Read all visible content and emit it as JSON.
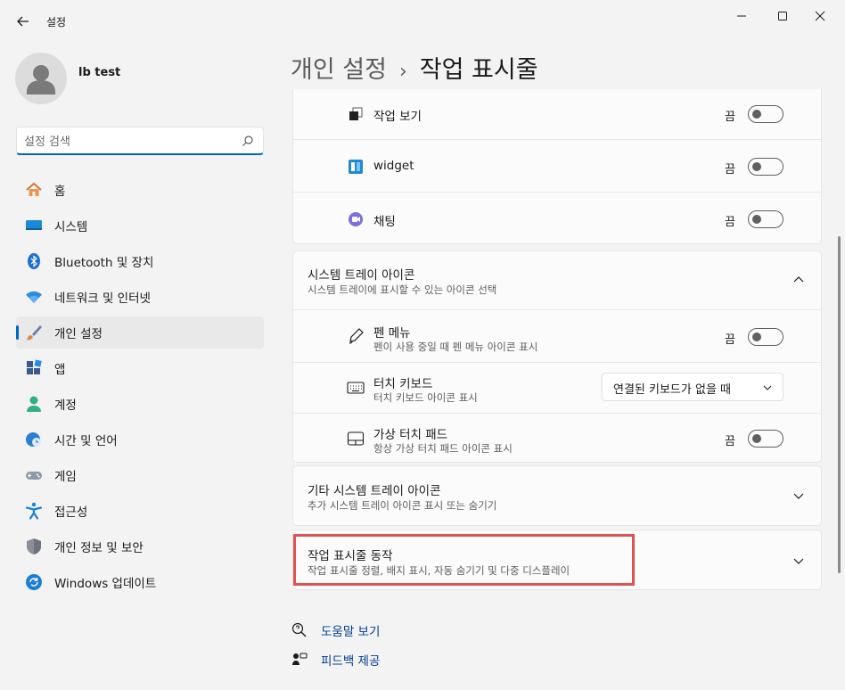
{
  "window": {
    "title": "설정"
  },
  "profile": {
    "name": "lb test"
  },
  "search": {
    "placeholder": "설정 검색"
  },
  "sidebar": {
    "items": [
      {
        "label": "홈",
        "icon": "home-icon"
      },
      {
        "label": "시스템",
        "icon": "system-icon"
      },
      {
        "label": "Bluetooth 및 장치",
        "icon": "bluetooth-icon"
      },
      {
        "label": "네트워크 및 인터넷",
        "icon": "network-icon"
      },
      {
        "label": "개인 설정",
        "icon": "personalization-brush-icon",
        "active": true
      },
      {
        "label": "앱",
        "icon": "apps-icon"
      },
      {
        "label": "계정",
        "icon": "account-icon"
      },
      {
        "label": "시간 및 언어",
        "icon": "time-language-icon"
      },
      {
        "label": "게임",
        "icon": "gaming-icon"
      },
      {
        "label": "접근성",
        "icon": "accessibility-icon"
      },
      {
        "label": "개인 정보 및 보안",
        "icon": "shield-icon"
      },
      {
        "label": "Windows 업데이트",
        "icon": "windows-update-icon"
      }
    ]
  },
  "breadcrumb": {
    "parent": "개인 설정",
    "separator": "›",
    "current": "작업 표시줄"
  },
  "taskbar_items": [
    {
      "label": "작업 보기",
      "state": "끔",
      "on": false
    },
    {
      "label": "widget",
      "state": "끔",
      "on": false
    },
    {
      "label": "채팅",
      "state": "끔",
      "on": false
    }
  ],
  "system_tray": {
    "title": "시스템 트레이 아이콘",
    "subtitle": "시스템 트레이에 표시할 수 있는 아이콘 선택",
    "items": [
      {
        "title": "펜 메뉴",
        "subtitle": "펜이 사용 중일 때 펜 메뉴 아이콘 표시",
        "state": "끔",
        "on": false
      },
      {
        "title": "터치 키보드",
        "subtitle": "터치 키보드 아이콘 표시",
        "dropdown_value": "연결된 키보드가 없을 때"
      },
      {
        "title": "가상 터치 패드",
        "subtitle": "항상 가상 터치 패드 아이콘 표시",
        "state": "끔",
        "on": false
      }
    ]
  },
  "other_tray": {
    "title": "기타 시스템 트레이 아이콘",
    "subtitle": "추가 시스템 트레이 아이콘 표시 또는 숨기기"
  },
  "taskbar_behavior": {
    "title": "작업 표시줄 동작",
    "subtitle": "작업 표시줄 정렬, 배지 표시, 자동 숨기기 및 다중 디스플레이"
  },
  "links": {
    "help": "도움말 보기",
    "feedback": "피드백 제공"
  },
  "colors": {
    "accent": "#0067c0",
    "highlight": "#e0514f",
    "link": "#003e92"
  }
}
